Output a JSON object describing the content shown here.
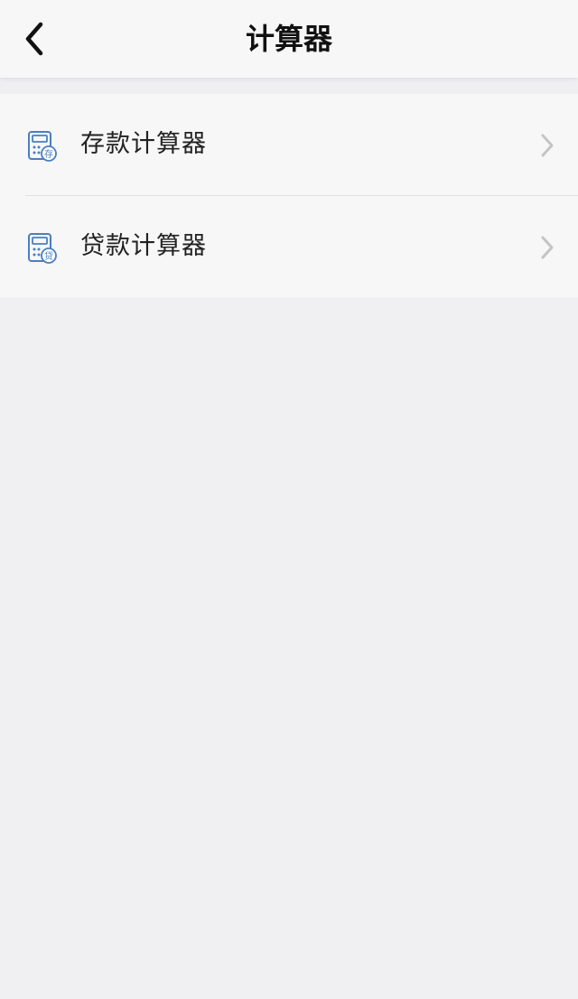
{
  "header": {
    "title": "计算器",
    "back_icon": "chevron-left-icon"
  },
  "menu": {
    "items": [
      {
        "label": "存款计算器",
        "icon": "calculator-deposit-icon",
        "icon_char": "存",
        "arrow": "chevron-right-icon"
      },
      {
        "label": "贷款计算器",
        "icon": "calculator-loan-icon",
        "icon_char": "贷",
        "arrow": "chevron-right-icon"
      }
    ]
  },
  "colors": {
    "icon_blue": "#4a7fc0",
    "chevron_gray": "#c4c4c6",
    "background": "#f0eff2",
    "card": "#f7f7f8"
  }
}
